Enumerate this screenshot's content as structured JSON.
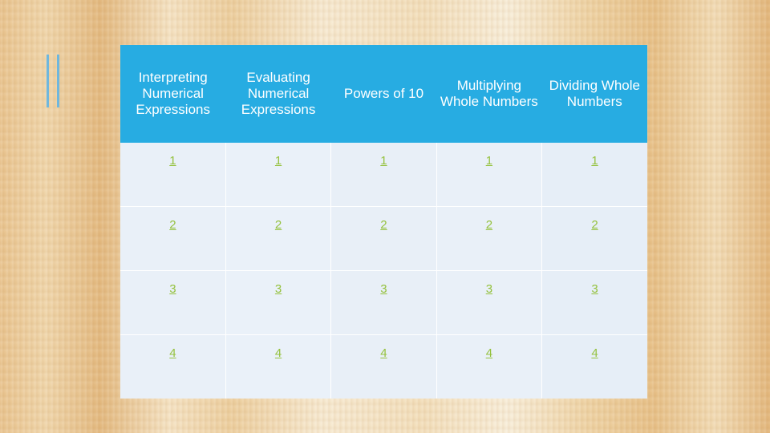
{
  "slide": {
    "accent_color": "#27ace2",
    "cell_text_color": "#94c13d",
    "background": "wood-texture"
  },
  "table": {
    "headers": [
      "Interpreting Numerical Expressions",
      "Evaluating Numerical Expressions",
      "Powers of 10",
      "Multiplying Whole Numbers",
      "Dividing Whole Numbers"
    ],
    "rows": [
      [
        "1",
        "1",
        "1",
        "1",
        "1"
      ],
      [
        "2",
        "2",
        "2",
        "2",
        "2"
      ],
      [
        "3",
        "3",
        "3",
        "3",
        "3"
      ],
      [
        "4",
        "4",
        "4",
        "4",
        "4"
      ]
    ]
  }
}
